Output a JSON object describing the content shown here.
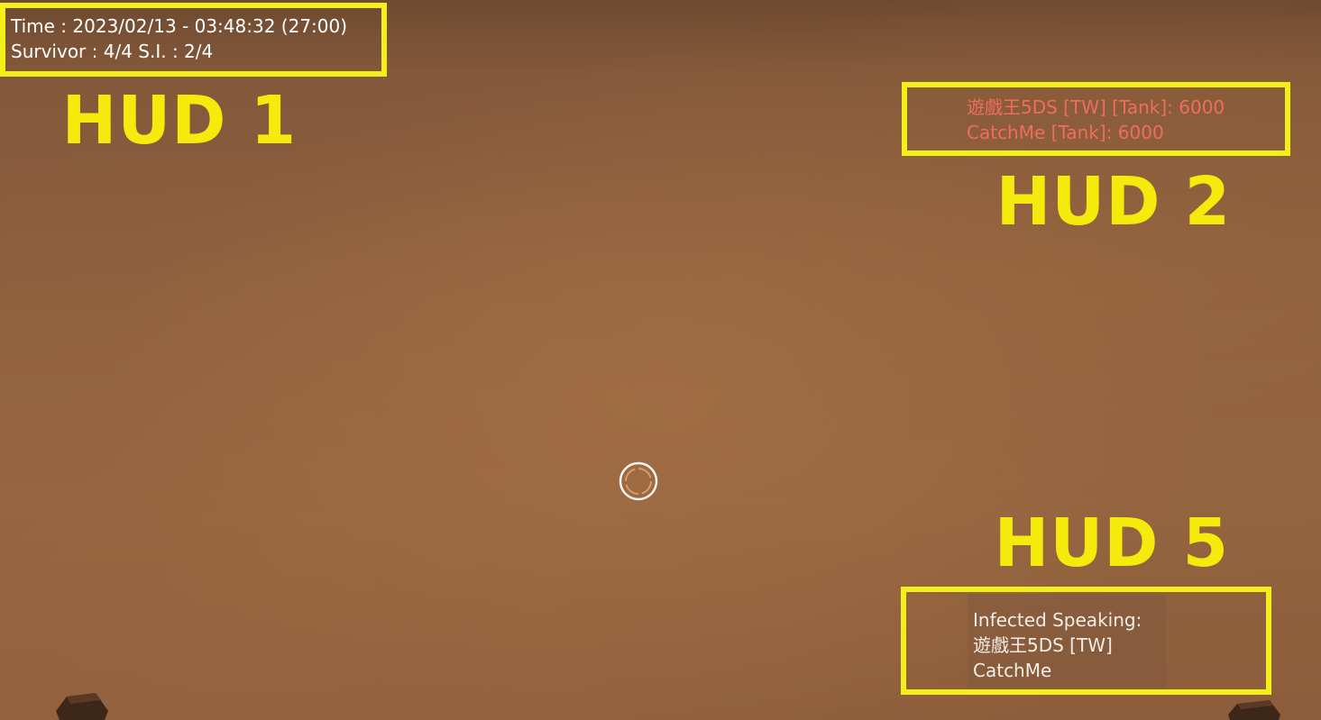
{
  "hud1": {
    "label": "HUD  1",
    "line1": "Time : 2023/02/13 - 03:48:32 (27:00)",
    "line2": "Survivor : 4/4  S.I. : 2/4"
  },
  "hud2": {
    "label": "HUD  2",
    "line1": "遊戲王5DS [TW] [Tank]: 6000",
    "line2": "CatchMe [Tank]: 6000"
  },
  "hud5": {
    "label": "HUD  5",
    "line1": "Infected Speaking:",
    "line2": "遊戲王5DS [TW]",
    "line3": "CatchMe"
  },
  "colors": {
    "highlight": "#f2ef1a",
    "tank_text": "#ef6d5a",
    "sky": "#8e5f3e"
  },
  "icons": {
    "crosshair": "crosshair-icon"
  }
}
